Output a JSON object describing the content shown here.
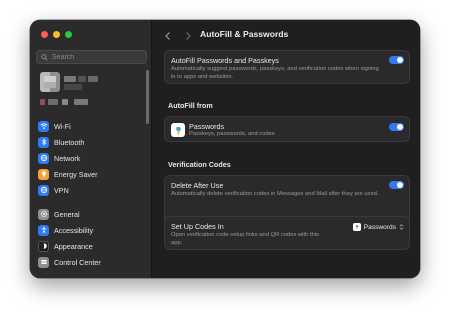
{
  "window": {
    "title": "AutoFill & Passwords"
  },
  "sidebar": {
    "search_placeholder": "Search",
    "items": [
      {
        "label": "Wi-Fi",
        "icon": "wifi-icon",
        "color": "#2f7bf6"
      },
      {
        "label": "Bluetooth",
        "icon": "bluetooth-icon",
        "color": "#2f7bf6"
      },
      {
        "label": "Network",
        "icon": "globe-icon",
        "color": "#2f7bf6"
      },
      {
        "label": "Energy Saver",
        "icon": "lightbulb-icon",
        "color": "#f2a33a"
      },
      {
        "label": "VPN",
        "icon": "vpn-globe-icon",
        "color": "#2f7bf6"
      },
      {
        "label": "General",
        "icon": "gear-icon",
        "color": "#8e8e93"
      },
      {
        "label": "Accessibility",
        "icon": "accessibility-icon",
        "color": "#2f7bf6"
      },
      {
        "label": "Appearance",
        "icon": "appearance-icon",
        "color": "#1c1c1e"
      },
      {
        "label": "Control Center",
        "icon": "control-center-icon",
        "color": "#8e8e93"
      }
    ]
  },
  "main": {
    "autofill_card": {
      "title": "AutoFill Passwords and Passkeys",
      "subtitle": "Automatically suggest passwords, passkeys, and verification codes when signing in to apps and websites.",
      "enabled": true
    },
    "autofill_from": {
      "heading": "AutoFill from",
      "item_title": "Passwords",
      "item_subtitle": "Passkeys, passwords, and codes",
      "enabled": true
    },
    "verification_codes": {
      "heading": "Verification Codes",
      "delete_title": "Delete After Use",
      "delete_subtitle": "Automatically delete verification codes in Messages and Mail after they are used.",
      "delete_enabled": true,
      "setup_title": "Set Up Codes In",
      "setup_subtitle": "Open verification code setup links and QR codes with this app.",
      "setup_value": "Passwords"
    }
  },
  "colors": {
    "accent": "#3478f6",
    "window_bg": "#1f1f20",
    "sidebar_bg": "#2b2b2c",
    "card_bg": "#2a2a2b"
  }
}
